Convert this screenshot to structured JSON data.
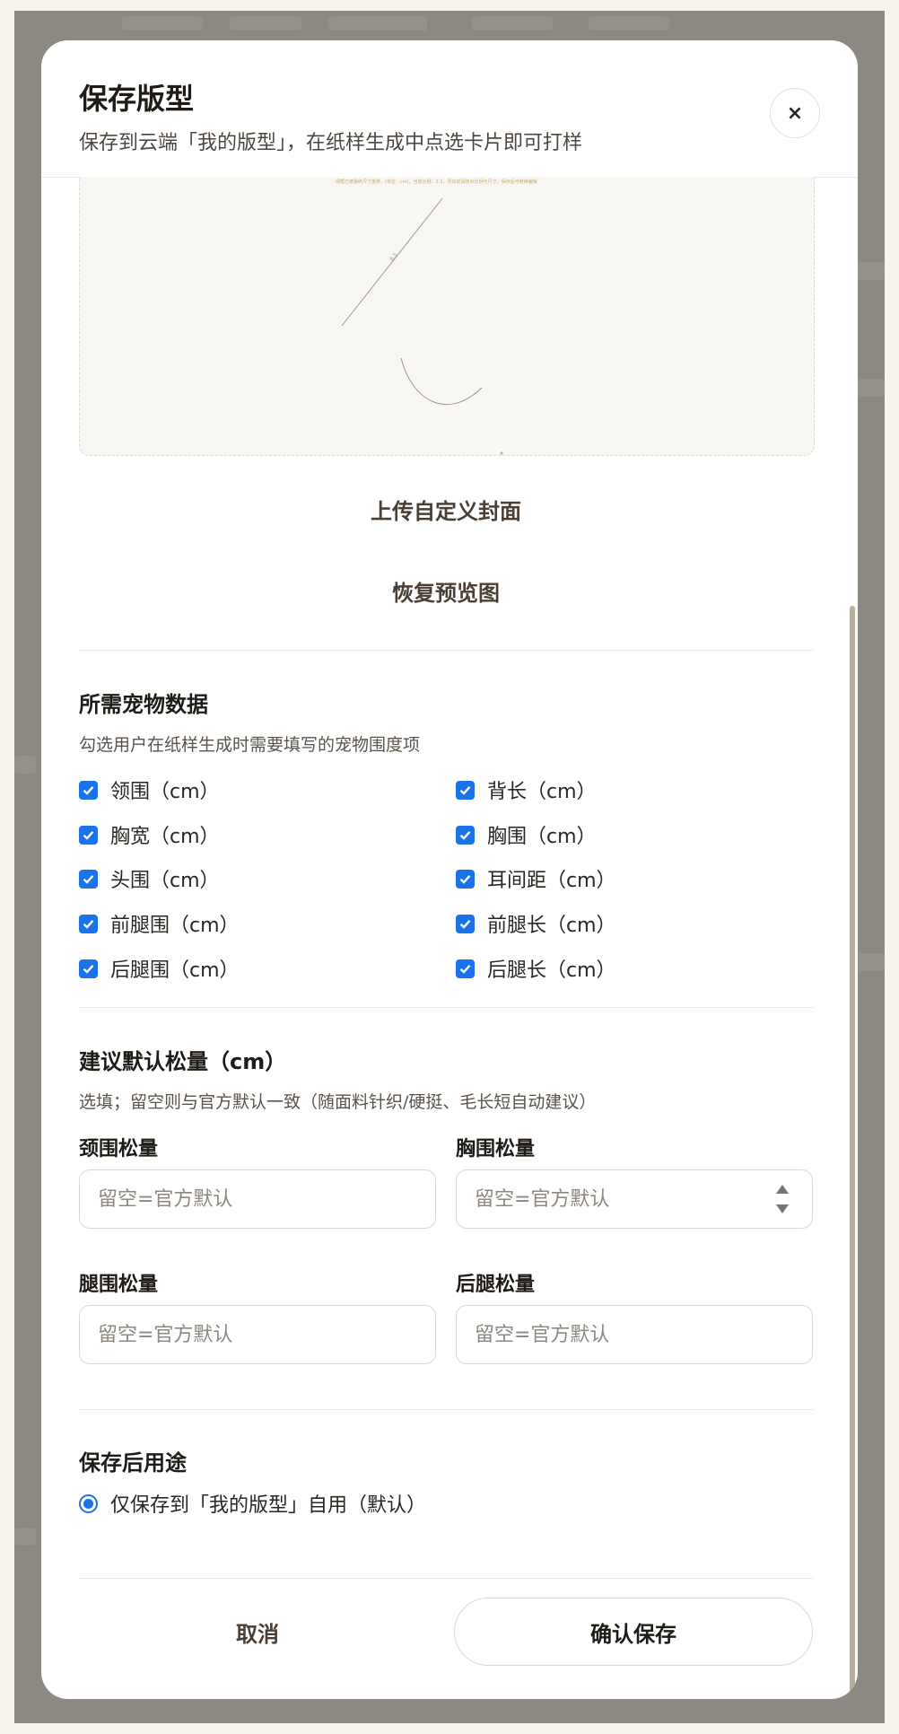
{
  "dialog": {
    "title": "保存版型",
    "subtitle": "保存到云端「我的版型」，在纸样生成中点选卡片即可打样",
    "close_label": "×"
  },
  "preview": {
    "note": "绿框已按最终尺寸重排，(单位：cm)，当前比例：1:1，导出前请核对比例与尺寸，保存后可继续编辑"
  },
  "cover": {
    "upload_label": "上传自定义封面",
    "restore_label": "恢复预览图"
  },
  "pet_data": {
    "title": "所需宠物数据",
    "desc": "勾选用户在纸样生成时需要填写的宠物围度项",
    "items": [
      {
        "label": "领围（cm）",
        "checked": true
      },
      {
        "label": "背长（cm）",
        "checked": true
      },
      {
        "label": "胸宽（cm）",
        "checked": true
      },
      {
        "label": "胸围（cm）",
        "checked": true
      },
      {
        "label": "头围（cm）",
        "checked": true
      },
      {
        "label": "耳间距（cm）",
        "checked": true
      },
      {
        "label": "前腿围（cm）",
        "checked": true
      },
      {
        "label": "前腿长（cm）",
        "checked": true
      },
      {
        "label": "后腿围（cm）",
        "checked": true
      },
      {
        "label": "后腿长（cm）",
        "checked": true
      }
    ]
  },
  "ease": {
    "title": "建议默认松量（cm）",
    "desc": "选填；留空则与官方默认一致（随面料针织/硬挺、毛长短自动建议）",
    "fields": [
      {
        "label": "颈围松量",
        "placeholder": "留空=官方默认",
        "value": ""
      },
      {
        "label": "胸围松量",
        "placeholder": "留空=官方默认",
        "value": ""
      },
      {
        "label": "腿围松量",
        "placeholder": "留空=官方默认",
        "value": ""
      },
      {
        "label": "后腿松量",
        "placeholder": "留空=官方默认",
        "value": ""
      }
    ]
  },
  "usage": {
    "title": "保存后用途",
    "option_label": "仅保存到「我的版型」自用（默认）",
    "selected": true
  },
  "footer": {
    "cancel_label": "取消",
    "confirm_label": "确认保存"
  },
  "colors": {
    "accent": "#1a73e8",
    "backdrop": "#8c8983",
    "button_text": "#4a3f34"
  }
}
